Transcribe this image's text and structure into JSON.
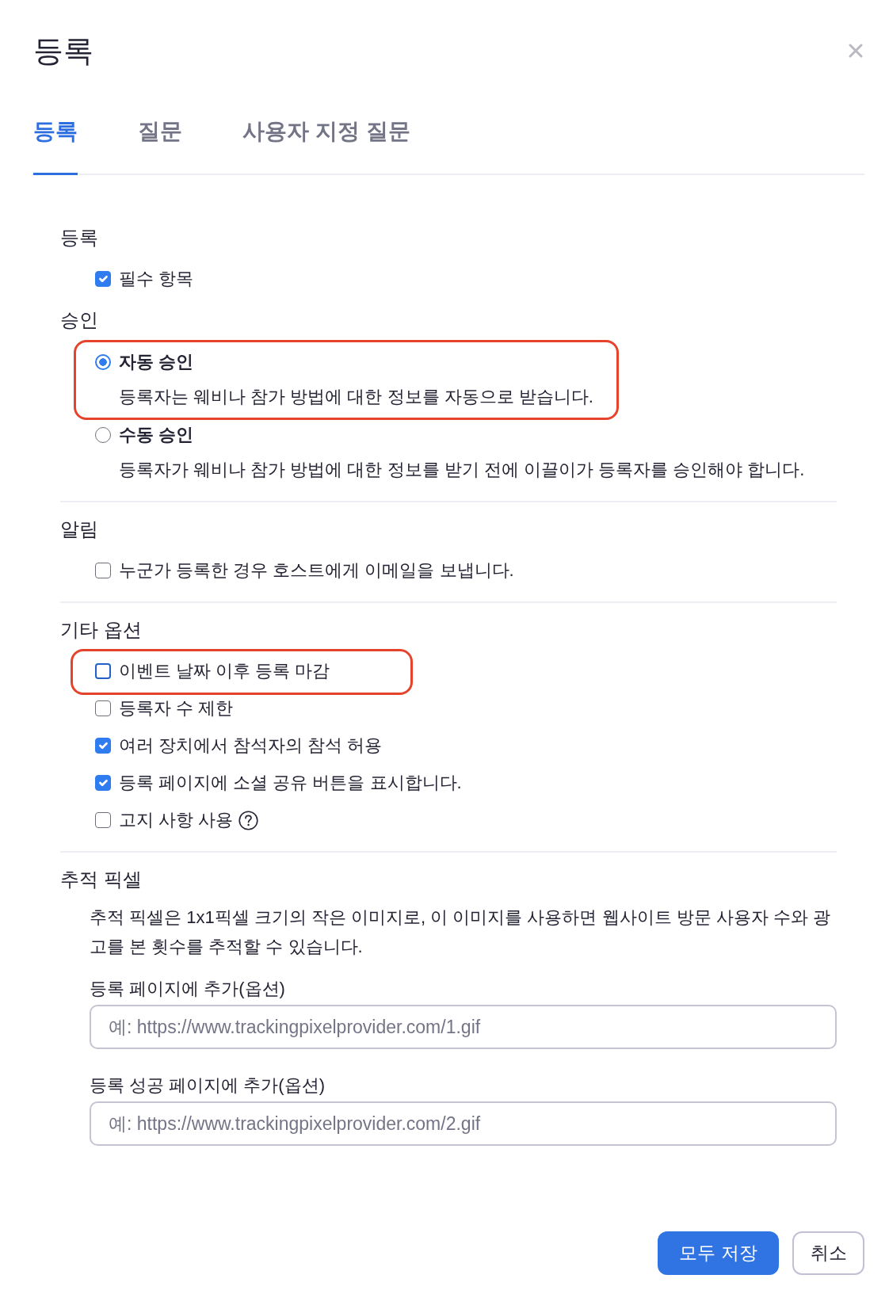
{
  "dialog": {
    "title": "등록"
  },
  "tabs": [
    {
      "label": "등록",
      "selected": true
    },
    {
      "label": "질문",
      "selected": false
    },
    {
      "label": "사용자 지정 질문",
      "selected": false
    }
  ],
  "groups": [
    {
      "sections": [
        {
          "kind": "checkboxes",
          "heading": "등록",
          "options": [
            {
              "label": "필수 항목",
              "checked": true
            }
          ]
        },
        {
          "kind": "radios",
          "heading": "승인",
          "options": [
            {
              "label": "자동 승인",
              "description": "등록자는 웨비나 참가 방법에 대한 정보를 자동으로 받습니다.",
              "selected": true,
              "highlighted": true
            },
            {
              "label": "수동 승인",
              "description": "등록자가 웨비나 참가 방법에 대한 정보를 받기 전에 이끌이가 등록자를 승인해야 합니다.",
              "selected": false,
              "highlighted": false
            }
          ]
        }
      ]
    },
    {
      "sections": [
        {
          "kind": "checkboxes",
          "heading": "알림",
          "options": [
            {
              "label": "누군가 등록한 경우 호스트에게 이메일을 보냅니다.",
              "checked": false
            }
          ]
        }
      ]
    },
    {
      "sections": [
        {
          "kind": "checkboxes",
          "heading": "기타 옵션",
          "options": [
            {
              "label": "이벤트 날짜 이후 등록 마감",
              "checked": false,
              "focused": true,
              "highlighted": true
            },
            {
              "label": "등록자 수 제한",
              "checked": false,
              "focused": false,
              "highlighted": false
            },
            {
              "label": "여러 장치에서 참석자의 참석 허용",
              "checked": true,
              "focused": false,
              "highlighted": false
            },
            {
              "label": "등록 페이지에 소셜 공유 버튼을 표시합니다.",
              "checked": true,
              "focused": false,
              "highlighted": false
            },
            {
              "label": "고지 사항 사용",
              "checked": false,
              "focused": false,
              "highlighted": false,
              "help": true
            }
          ]
        }
      ]
    },
    {
      "sections": [
        {
          "kind": "tracking",
          "heading": "추적 픽셀",
          "description": "추적 픽셀은 1x1픽셀 크기의 작은 이미지로, 이 이미지를 사용하면 웹사이트 방문 사용자 수와 광고를 본 횟수를 추적할 수 있습니다.",
          "fields": [
            {
              "label": "등록 페이지에 추가(옵션)",
              "placeholder": "예: https://www.trackingpixelprovider.com/1.gif"
            },
            {
              "label": "등록 성공 페이지에 추가(옵션)",
              "placeholder": "예: https://www.trackingpixelprovider.com/2.gif"
            }
          ]
        }
      ]
    }
  ],
  "buttons": [
    {
      "label": "모두 저장",
      "kind": "primary"
    },
    {
      "label": "취소",
      "kind": "secondary"
    }
  ]
}
